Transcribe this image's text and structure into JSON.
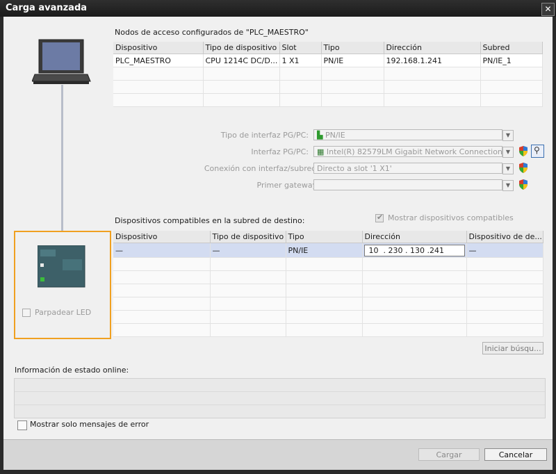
{
  "window": {
    "title": "Carga avanzada",
    "close_icon": "close-icon"
  },
  "nodes": {
    "title": "Nodos de acceso configurados de \"PLC_MAESTRO\"",
    "columns": [
      "Dispositivo",
      "Tipo de dispositivo",
      "Slot",
      "Tipo",
      "Dirección",
      "Subred"
    ],
    "rows": [
      [
        "PLC_MAESTRO",
        "CPU 1214C DC/D...",
        "1 X1",
        "PN/IE",
        "192.168.1.241",
        "PN/IE_1"
      ]
    ]
  },
  "interface": {
    "type_label": "Tipo de interfaz PG/PC:",
    "type_value": "PN/IE",
    "iface_label": "Interfaz PG/PC:",
    "iface_value": "Intel(R) 82579LM Gigabit Network Connection",
    "connection_label": "Conexión con interfaz/subred:",
    "connection_value": "Directo a slot '1 X1'",
    "gateway_label": "Primer gateway:",
    "gateway_value": ""
  },
  "compatible": {
    "title": "Dispositivos compatibles en la subred de destino:",
    "show_label": "Mostrar dispositivos compatibles",
    "show_checked": true,
    "columns": [
      "Dispositivo",
      "Tipo de dispositivo",
      "Tipo",
      "Dirección",
      "Dispositivo de de..."
    ],
    "rows": [
      [
        "—",
        "—",
        "PN/IE",
        "",
        "—"
      ]
    ],
    "ip": [
      "10",
      ".",
      "230",
      ".",
      "130",
      ".",
      "241"
    ]
  },
  "left": {
    "blink_label": "Parpadear LED"
  },
  "search_button": "Iniciar búsqu...",
  "status": {
    "title": "Información de estado online:",
    "errors_only_label": "Mostrar solo mensajes de error"
  },
  "footer": {
    "load_label": "Cargar",
    "cancel_label": "Cancelar"
  },
  "colors": {
    "accent_orange": "#f0a020",
    "selection_row": "#d3dcf1",
    "title_bar": "#1b1b1b"
  }
}
